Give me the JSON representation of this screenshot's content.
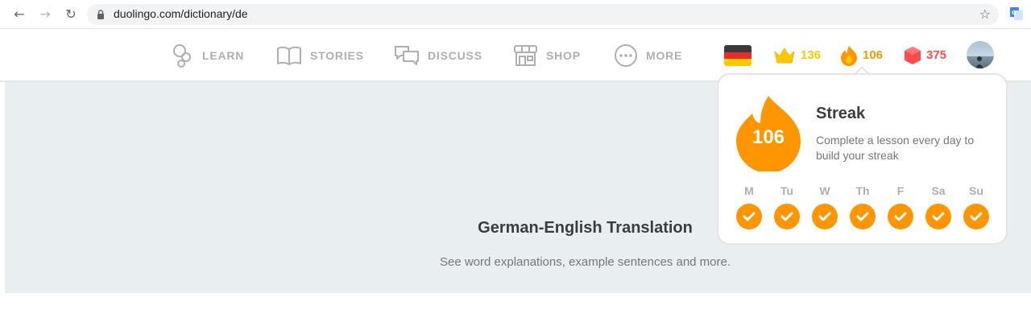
{
  "browser": {
    "url": "duolingo.com/dictionary/de",
    "back_icon": "back-arrow-icon",
    "forward_icon": "forward-arrow-icon",
    "reload_icon": "reload-icon",
    "bookmark_icon": "star-icon"
  },
  "nav": {
    "items": [
      {
        "label": "LEARN",
        "icon": "learn-icon"
      },
      {
        "label": "STORIES",
        "icon": "book-icon"
      },
      {
        "label": "DISCUSS",
        "icon": "chat-bubbles-icon"
      },
      {
        "label": "SHOP",
        "icon": "shop-icon"
      },
      {
        "label": "MORE",
        "icon": "more-dots-icon"
      }
    ],
    "language_flag": "german-flag-icon",
    "crowns": "136",
    "streak": "106",
    "gems": "375",
    "colors": {
      "crown": "#ffc800",
      "streak": "#ff9600",
      "gems": "#ff4b4b"
    }
  },
  "hero": {
    "title": "German-English Translation",
    "subtitle": "See word explanations, example sentences and more."
  },
  "streak_popover": {
    "count": "106",
    "title": "Streak",
    "description": "Complete a lesson every day to build your streak",
    "days": [
      "M",
      "Tu",
      "W",
      "Th",
      "F",
      "Sa",
      "Su"
    ],
    "accent": "#ff9600"
  }
}
